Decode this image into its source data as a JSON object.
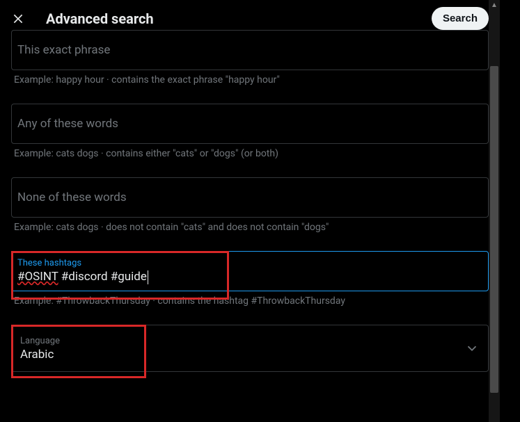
{
  "header": {
    "title": "Advanced search",
    "search_button": "Search"
  },
  "fields": {
    "exact_phrase": {
      "label": "This exact phrase",
      "example": "Example: happy hour · contains the exact phrase \"happy hour\""
    },
    "any_words": {
      "label": "Any of these words",
      "example": "Example: cats dogs · contains either \"cats\" or \"dogs\" (or both)"
    },
    "none_words": {
      "label": "None of these words",
      "example": "Example: cats dogs · does not contain \"cats\" and does not contain \"dogs\""
    },
    "hashtags": {
      "label": "These hashtags",
      "value": "#OSINT #discord #guide",
      "example": "Example: #ThrowbackThursday · contains the hashtag #ThrowbackThursday"
    },
    "language": {
      "label": "Language",
      "value": "Arabic"
    }
  }
}
